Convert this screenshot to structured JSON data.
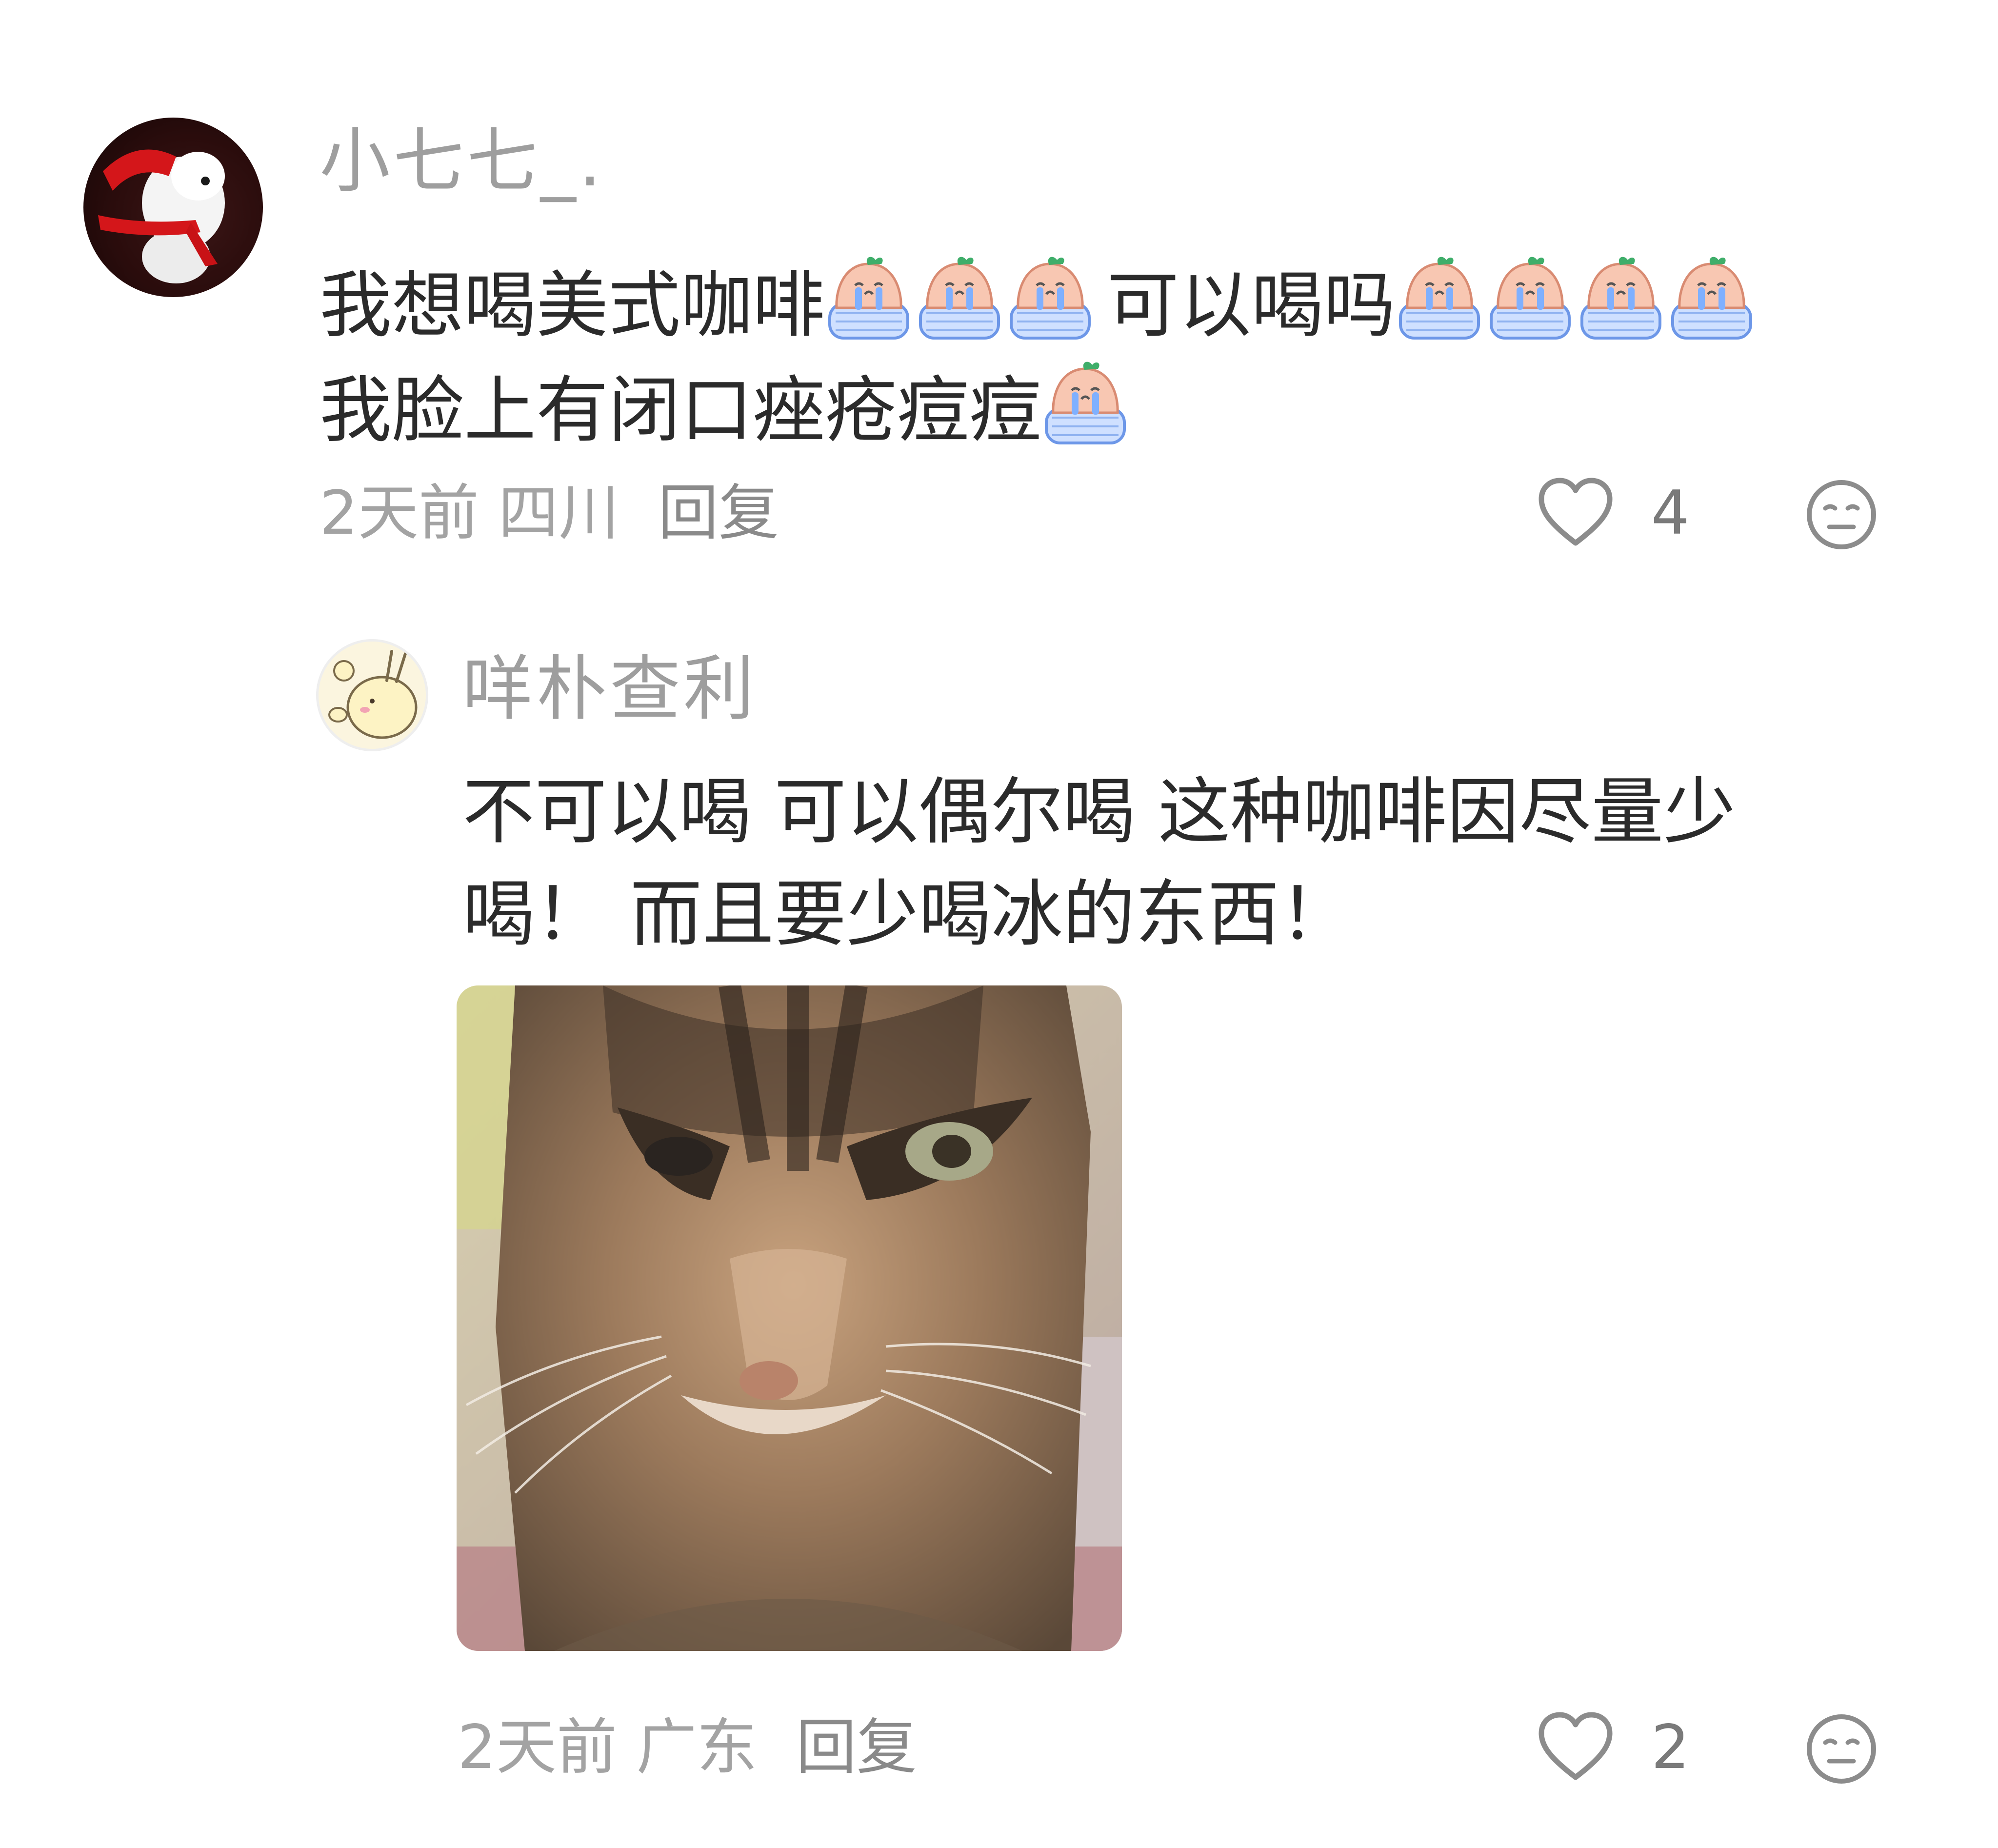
{
  "comments": [
    {
      "username": "小七七_.",
      "text_line1_part1": "我想喝美式咖啡",
      "text_line1_part2": "可以喝吗",
      "text_line2": "我脸上有闭口痤疮痘痘",
      "emoji_after_part1": 3,
      "emoji_after_part2": 4,
      "emoji_after_line2": 1,
      "emoji_icon": "crying-peach-emoji",
      "time": "2天前",
      "location": "四川",
      "reply_label": "回复",
      "likes": "4"
    },
    {
      "username": "咩朴查利",
      "text_line1": "不可以喝 可以偶尔喝 这种咖啡因尽量少",
      "text_line2": "喝！ 而且要少喝冰的东西！",
      "image": "cat-photo",
      "time": "2天前",
      "location": "广东",
      "reply_label": "回复",
      "likes": "2"
    }
  ],
  "icons": {
    "like": "heart-outline-icon",
    "dislike": "meh-face-icon"
  },
  "colors": {
    "username": "#9e9e9e",
    "text": "#2b2b2b",
    "meta": "#a3a3a3",
    "icon": "#8c8c8c"
  }
}
